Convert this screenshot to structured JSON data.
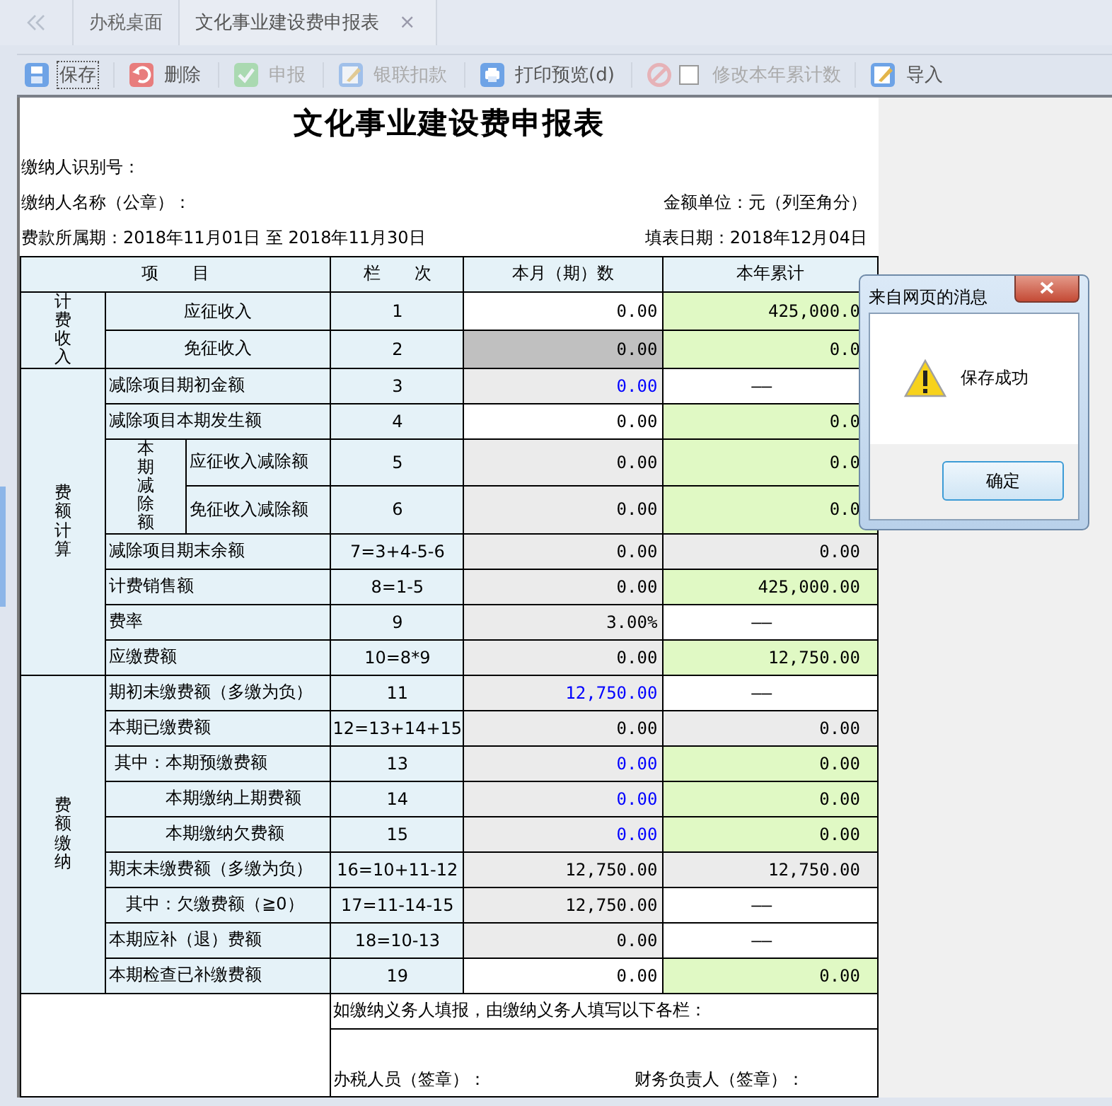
{
  "tabs": [
    {
      "label": "办税桌面",
      "selected": false
    },
    {
      "label": "文化事业建设费申报表",
      "selected": true,
      "close": "×"
    }
  ],
  "toolbar": [
    {
      "kind": "button",
      "label": "保存",
      "disabled": false,
      "focused": true
    },
    {
      "kind": "button",
      "label": "删除",
      "disabled": false,
      "focused": false
    },
    {
      "kind": "button",
      "label": "申报",
      "disabled": true,
      "focused": false
    },
    {
      "kind": "button",
      "label": "银联扣款",
      "disabled": true,
      "focused": false
    },
    {
      "kind": "button",
      "label": "打印预览(d)",
      "disabled": false,
      "focused": false
    },
    {
      "kind": "checkbox",
      "label": "修改本年累计数",
      "disabled": true,
      "checked": false
    },
    {
      "kind": "button",
      "label": "导入",
      "disabled": false,
      "focused": false
    }
  ],
  "form": {
    "title": "文化事业建设费申报表",
    "taxpayer_id": "缴纳人识别号：",
    "taxpayer_name": "缴纳人名称（公章）：",
    "unit": "金额单位：元（列至角分）",
    "period": "费款所属期：2018年11月01日 至 2018年11月30日",
    "fill_date": "填表日期：2018年12月04日",
    "columns": [
      "项　　目",
      "栏　　次",
      "本月（期）数",
      "本年累计"
    ],
    "sections": [
      {
        "label": "计费收入",
        "rows": [
          {
            "item": "应征收入",
            "line": "1",
            "month": {
              "value": "0.00",
              "kind": "input"
            },
            "year": {
              "value": "425,000.0",
              "kind": "annual"
            }
          },
          {
            "item": "免征收入",
            "line": "2",
            "month": {
              "value": "0.00",
              "kind": "locked"
            },
            "year": {
              "value": "0.0",
              "kind": "annual"
            }
          }
        ]
      },
      {
        "label": "费额计算",
        "rows": [
          {
            "item": "减除项目期初金额",
            "line": "3",
            "month": {
              "value": "0.00",
              "kind": "fetched"
            },
            "year": {
              "value": "——",
              "kind": "input"
            }
          },
          {
            "item": "减除项目本期发生额",
            "line": "4",
            "month": {
              "value": "0.00",
              "kind": "input"
            },
            "year": {
              "value": "0.0",
              "kind": "annual"
            }
          },
          {
            "label": "本期减除额",
            "children": [
              {
                "item": "应征收入减除额",
                "line": "5",
                "month": {
                  "value": "0.00",
                  "kind": "calc"
                },
                "year": {
                  "value": "0.0",
                  "kind": "annual"
                }
              },
              {
                "item": "免征收入减除额",
                "line": "6",
                "month": {
                  "value": "0.00",
                  "kind": "calc"
                },
                "year": {
                  "value": "0.0",
                  "kind": "annual"
                }
              }
            ]
          },
          {
            "item": "减除项目期末余额",
            "line": "7=3+4-5-6",
            "month": {
              "value": "0.00",
              "kind": "calc"
            },
            "year": {
              "value": "0.00",
              "kind": "calc"
            }
          },
          {
            "item": "计费销售额",
            "line": "8=1-5",
            "month": {
              "value": "0.00",
              "kind": "calc"
            },
            "year": {
              "value": "425,000.00",
              "kind": "annual"
            }
          },
          {
            "item": "费率",
            "line": "9",
            "month": {
              "value": "3.00%",
              "kind": "calc"
            },
            "year": {
              "value": "——",
              "kind": "input"
            }
          },
          {
            "item": "应缴费额",
            "line": "10=8*9",
            "month": {
              "value": "0.00",
              "kind": "calc"
            },
            "year": {
              "value": "12,750.00",
              "kind": "annual"
            }
          }
        ]
      },
      {
        "label": "费额缴纳",
        "rows": [
          {
            "item": "期初未缴费额（多缴为负）",
            "line": "11",
            "month": {
              "value": "12,750.00",
              "kind": "fetched"
            },
            "year": {
              "value": "——",
              "kind": "input"
            }
          },
          {
            "item": "本期已缴费额",
            "line": "12=13+14+15",
            "month": {
              "value": "0.00",
              "kind": "calc"
            },
            "year": {
              "value": "0.00",
              "kind": "calc"
            }
          },
          {
            "item": " 其中：本期预缴费额",
            "line": "13",
            "month": {
              "value": "0.00",
              "kind": "fetched"
            },
            "year": {
              "value": "0.00",
              "kind": "annual"
            }
          },
          {
            "item": "　　　 本期缴纳上期费额",
            "line": "14",
            "month": {
              "value": "0.00",
              "kind": "fetched"
            },
            "year": {
              "value": "0.00",
              "kind": "annual"
            }
          },
          {
            "item": "　　　 本期缴纳欠费额",
            "line": "15",
            "month": {
              "value": "0.00",
              "kind": "fetched"
            },
            "year": {
              "value": "0.00",
              "kind": "annual"
            }
          },
          {
            "item": "期末未缴费额（多缴为负）",
            "line": "16=10+11-12",
            "month": {
              "value": "12,750.00",
              "kind": "calc"
            },
            "year": {
              "value": "12,750.00",
              "kind": "calc"
            }
          },
          {
            "item": "　其中：欠缴费额（≧0）",
            "line": "17=11-14-15",
            "month": {
              "value": "12,750.00",
              "kind": "calc"
            },
            "year": {
              "value": "——",
              "kind": "input"
            }
          },
          {
            "item": "本期应补（退）费额",
            "line": "18=10-13",
            "month": {
              "value": "0.00",
              "kind": "calc"
            },
            "year": {
              "value": "——",
              "kind": "input"
            }
          },
          {
            "item": "本期检查已补缴费额",
            "line": "19",
            "month": {
              "value": "0.00",
              "kind": "input"
            },
            "year": {
              "value": "0.00",
              "kind": "annual"
            }
          }
        ]
      }
    ],
    "agent_note": "如缴纳义务人填报，由缴纳义务人填写以下各栏：",
    "handler_sign": "办税人员（签章）：",
    "finance_sign": "财务负责人（签章）："
  },
  "dialog": {
    "title": "来自网页的消息",
    "message": "保存成功",
    "button": "确定"
  }
}
